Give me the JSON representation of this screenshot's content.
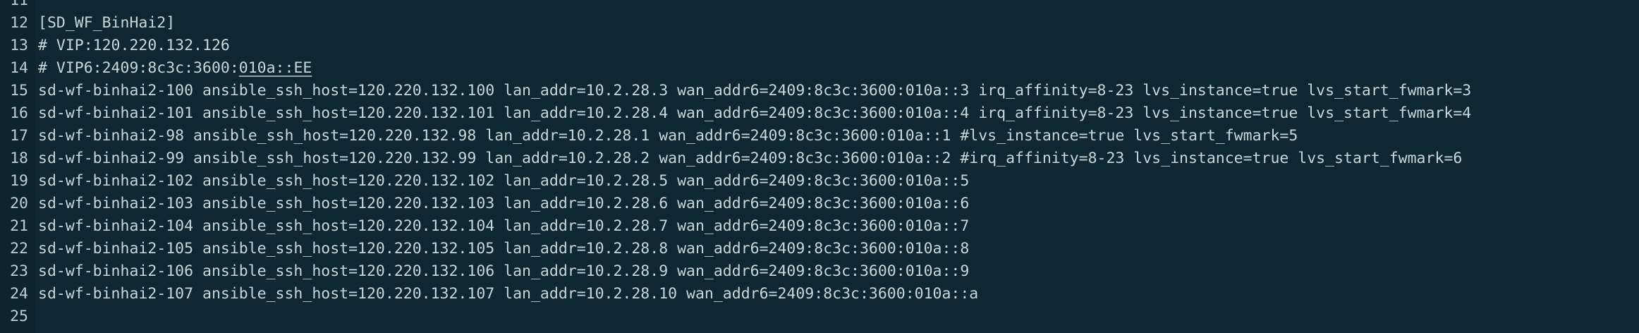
{
  "editor": {
    "lines": [
      {
        "num": "11",
        "text": ""
      },
      {
        "num": "12",
        "text": "[SD_WF_BinHai2]"
      },
      {
        "num": "13",
        "text": "# VIP:120.220.132.126"
      },
      {
        "num": "14",
        "text_a": "# VIP6:2409:8c3c:3600:",
        "text_b": "010a::EE"
      },
      {
        "num": "15",
        "text": "sd-wf-binhai2-100 ansible_ssh_host=120.220.132.100 lan_addr=10.2.28.3 wan_addr6=2409:8c3c:3600:010a::3 irq_affinity=8-23 lvs_instance=true lvs_start_fwmark=3"
      },
      {
        "num": "16",
        "text": "sd-wf-binhai2-101 ansible_ssh_host=120.220.132.101 lan_addr=10.2.28.4 wan_addr6=2409:8c3c:3600:010a::4 irq_affinity=8-23 lvs_instance=true lvs_start_fwmark=4"
      },
      {
        "num": "17",
        "text": "sd-wf-binhai2-98 ansible_ssh_host=120.220.132.98 lan_addr=10.2.28.1 wan_addr6=2409:8c3c:3600:010a::1 #lvs_instance=true lvs_start_fwmark=5"
      },
      {
        "num": "18",
        "text": "sd-wf-binhai2-99 ansible_ssh_host=120.220.132.99 lan_addr=10.2.28.2 wan_addr6=2409:8c3c:3600:010a::2 #irq_affinity=8-23 lvs_instance=true lvs_start_fwmark=6"
      },
      {
        "num": "19",
        "text": "sd-wf-binhai2-102 ansible_ssh_host=120.220.132.102 lan_addr=10.2.28.5 wan_addr6=2409:8c3c:3600:010a::5"
      },
      {
        "num": "20",
        "text": "sd-wf-binhai2-103 ansible_ssh_host=120.220.132.103 lan_addr=10.2.28.6 wan_addr6=2409:8c3c:3600:010a::6"
      },
      {
        "num": "21",
        "text": "sd-wf-binhai2-104 ansible_ssh_host=120.220.132.104 lan_addr=10.2.28.7 wan_addr6=2409:8c3c:3600:010a::7"
      },
      {
        "num": "22",
        "text": "sd-wf-binhai2-105 ansible_ssh_host=120.220.132.105 lan_addr=10.2.28.8 wan_addr6=2409:8c3c:3600:010a::8"
      },
      {
        "num": "23",
        "text": "sd-wf-binhai2-106 ansible_ssh_host=120.220.132.106 lan_addr=10.2.28.9 wan_addr6=2409:8c3c:3600:010a::9"
      },
      {
        "num": "24",
        "text": "sd-wf-binhai2-107 ansible_ssh_host=120.220.132.107 lan_addr=10.2.28.10 wan_addr6=2409:8c3c:3600:010a::a"
      },
      {
        "num": "25",
        "text": ""
      }
    ]
  },
  "colors": {
    "background": "#0d2833",
    "gutter": "#0b242e",
    "text": "#c8d6da",
    "line_number": "#c2ccd0"
  }
}
